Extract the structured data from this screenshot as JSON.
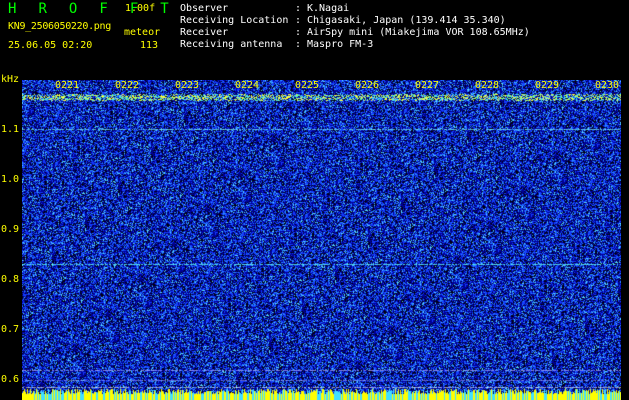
{
  "header": {
    "logo": "H R O F F T",
    "version": "1.00f",
    "filename": "KN9_2506050220.png",
    "mode": "meteor",
    "timestamp": "25.06.05 02:20",
    "count": "113"
  },
  "info": {
    "observer": {
      "label": "Observer",
      "value": "K.Nagai"
    },
    "location": {
      "label": "Receiving Location",
      "value": "Chigasaki, Japan (139.414 35.340)"
    },
    "receiver": {
      "label": "Receiver",
      "value": "AirSpy mini (Miakejima VOR 108.65MHz)"
    },
    "antenna": {
      "label": "Receiving antenna",
      "value": "Maspro FM-3"
    },
    "separator": ":"
  },
  "spectrogram": {
    "unit": "kHz",
    "time_ticks": [
      "0221",
      "0222",
      "0223",
      "0224",
      "0225",
      "0226",
      "0227",
      "0228",
      "0229",
      "0230"
    ],
    "freq_ticks": [
      "1.1",
      "1.0",
      "0.9",
      "0.8",
      "0.7",
      "0.6"
    ],
    "colors": {
      "background": "#000000",
      "noise_low": "#0000a0",
      "noise_mid": "#1a40ff",
      "noise_high": "#40c8ff",
      "carrier": "#ffff00"
    }
  }
}
